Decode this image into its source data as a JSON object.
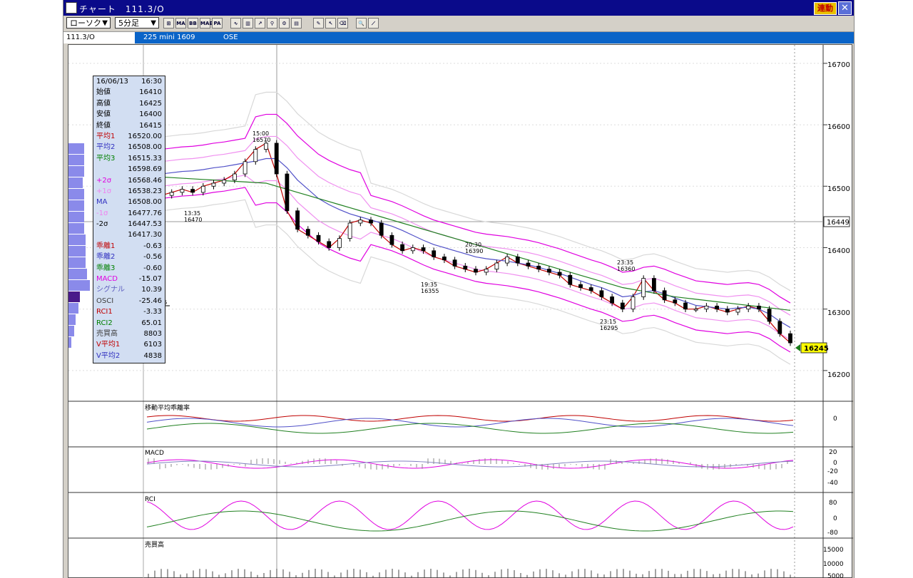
{
  "window": {
    "title": "チャート　111.3/O",
    "renkei_label": "連動",
    "close_glyph": "✕"
  },
  "toolbar": {
    "chart_type": "ローソク",
    "interval": "5分足",
    "buttons": [
      "MA",
      "BB",
      "MAE",
      "PA"
    ]
  },
  "info_bar": {
    "symbol_code": "111.3/O",
    "contract": "225 mini 1609",
    "exchange": "OSE"
  },
  "price_axis": {
    "ticks": [
      "16700",
      "16600",
      "16500",
      "16400",
      "16300",
      "16200"
    ],
    "cursor_price": "16449",
    "last_price": "16245"
  },
  "annotations": [
    {
      "text": "15:00\n16570"
    },
    {
      "text": "13:35\n16470"
    },
    {
      "text": "20:30\n16390"
    },
    {
      "text": "19:35\n16355"
    },
    {
      "text": "23:35\n16360"
    },
    {
      "text": "23:15\n16295"
    }
  ],
  "annotation_lines": {
    "a0": [
      "15:00",
      "16570"
    ],
    "a1": [
      "13:35",
      "16470"
    ],
    "a2": [
      "20:30",
      "16390"
    ],
    "a3": [
      "19:35",
      "16355"
    ],
    "a4": [
      "23:35",
      "16360"
    ],
    "a5": [
      "23:15",
      "16295"
    ]
  },
  "left_tick_label": "16",
  "info_box": {
    "date": "16/06/13",
    "time": "16:30",
    "rows": [
      {
        "k": "始値",
        "v": "16410",
        "color": "#000000"
      },
      {
        "k": "高値",
        "v": "16425",
        "color": "#000000"
      },
      {
        "k": "安値",
        "v": "16400",
        "color": "#000000"
      },
      {
        "k": "終値",
        "v": "16415",
        "color": "#000000"
      },
      {
        "k": "平均1",
        "v": "16520.00",
        "color": "#c00000"
      },
      {
        "k": "平均2",
        "v": "16508.00",
        "color": "#3030c0"
      },
      {
        "k": "平均3",
        "v": "16515.33",
        "color": "#008000"
      },
      {
        "k": "",
        "v": "16598.69",
        "color": "#000000"
      },
      {
        "k": "+2σ",
        "v": "16568.46",
        "color": "#e000e0"
      },
      {
        "k": "+1σ",
        "v": "16538.23",
        "color": "#f080f0"
      },
      {
        "k": "MA",
        "v": "16508.00",
        "color": "#3030c0"
      },
      {
        "k": "-1σ",
        "v": "16477.76",
        "color": "#f080f0"
      },
      {
        "k": "-2σ",
        "v": "16447.53",
        "color": "#000000"
      },
      {
        "k": "",
        "v": "16417.30",
        "color": "#000000"
      },
      {
        "k": "乖離1",
        "v": "-0.63",
        "color": "#c00000"
      },
      {
        "k": "乖離2",
        "v": "-0.56",
        "color": "#3030c0"
      },
      {
        "k": "乖離3",
        "v": "-0.60",
        "color": "#008000"
      },
      {
        "k": "MACD",
        "v": "-15.07",
        "color": "#e000e0"
      },
      {
        "k": "シグナル",
        "v": "10.39",
        "color": "#6060c0"
      },
      {
        "k": "OSCI",
        "v": "-25.46",
        "color": "#404040"
      },
      {
        "k": "RCI1",
        "v": "-3.33",
        "color": "#c00000"
      },
      {
        "k": "RCI2",
        "v": "65.01",
        "color": "#008000"
      },
      {
        "k": "売買高",
        "v": "8803",
        "color": "#404040"
      },
      {
        "k": "V平均1",
        "v": "6103",
        "color": "#c00000"
      },
      {
        "k": "V平均2",
        "v": "4838",
        "color": "#3030c0"
      }
    ]
  },
  "panels": {
    "kairi": {
      "title": "移動平均乖離率",
      "ticks": [
        "0"
      ]
    },
    "macd": {
      "title": "MACD",
      "ticks": [
        "20",
        "0",
        "-20",
        "-40"
      ]
    },
    "rci": {
      "title": "RCI",
      "ticks": [
        "80",
        "0",
        "-80"
      ]
    },
    "volume": {
      "title": "売買高",
      "ticks": [
        "15000",
        "10000",
        "5000"
      ]
    }
  },
  "colors": {
    "title_bar": "#0a0a8a",
    "info_bar": "#0a64c8",
    "candle_up": "#ffffff",
    "candle_down": "#000000",
    "ma1": "#c00000",
    "ma2": "#5050c8",
    "ma3": "#208020",
    "bollinger": "#e000e0",
    "last_price_bg": "#ffff00"
  },
  "chart_data": {
    "type": "line",
    "xlabel": "",
    "ylabel": "",
    "ylim": [
      16150,
      16730
    ],
    "series": [
      {
        "values": [
          16485,
          16490,
          16495,
          16490,
          16500,
          16505,
          16510,
          16520,
          16540,
          16560,
          16570,
          16520,
          16460,
          16430,
          16420,
          16410,
          16400,
          16415,
          16440,
          16445,
          16440,
          16420,
          16405,
          16395,
          16400,
          16395,
          16385,
          16380,
          16370,
          16365,
          16360,
          16365,
          16375,
          16385,
          16375,
          16370,
          16365,
          16360,
          16355,
          16340,
          16335,
          16330,
          16320,
          16310,
          16300,
          16320,
          16350,
          16330,
          16315,
          16310,
          16300,
          16300,
          16305,
          16300,
          16295,
          16300,
          16305,
          16300,
          16280,
          16260,
          16245
        ]
      },
      {
        "values": [
          16520,
          16522,
          16524,
          16525,
          16527,
          16530,
          16532,
          16535,
          16538,
          16541,
          16545,
          16545,
          16530,
          16510,
          16495,
          16480,
          16470,
          16462,
          16455,
          16450,
          16445,
          16440,
          16435,
          16428,
          16420,
          16412,
          16405,
          16400,
          16395,
          16390,
          16385,
          16382,
          16380,
          16378,
          16375,
          16372,
          16368,
          16363,
          16358,
          16352,
          16346,
          16340,
          16335,
          16328,
          16320,
          16322,
          16328,
          16330,
          16325,
          16318,
          16312,
          16306,
          16304,
          16302,
          16300,
          16302,
          16303,
          16300,
          16292,
          16280,
          16270
        ]
      },
      {
        "values": [
          16515,
          16514,
          16513,
          16512,
          16511,
          16510,
          16509,
          16508,
          16507,
          16506,
          16505,
          16500,
          16495,
          16490,
          16485,
          16480,
          16475,
          16470,
          16465,
          16460,
          16455,
          16450,
          16445,
          16440,
          16435,
          16430,
          16425,
          16420,
          16415,
          16410,
          16405,
          16400,
          16395,
          16390,
          16385,
          16380,
          16375,
          16370,
          16365,
          16360,
          16355,
          16350,
          16345,
          16340,
          16335,
          16332,
          16329,
          16326,
          16323,
          16320,
          16318,
          16316,
          16314,
          16312,
          16310,
          16308,
          16306,
          16304,
          16302,
          16300,
          16298
        ]
      }
    ]
  }
}
